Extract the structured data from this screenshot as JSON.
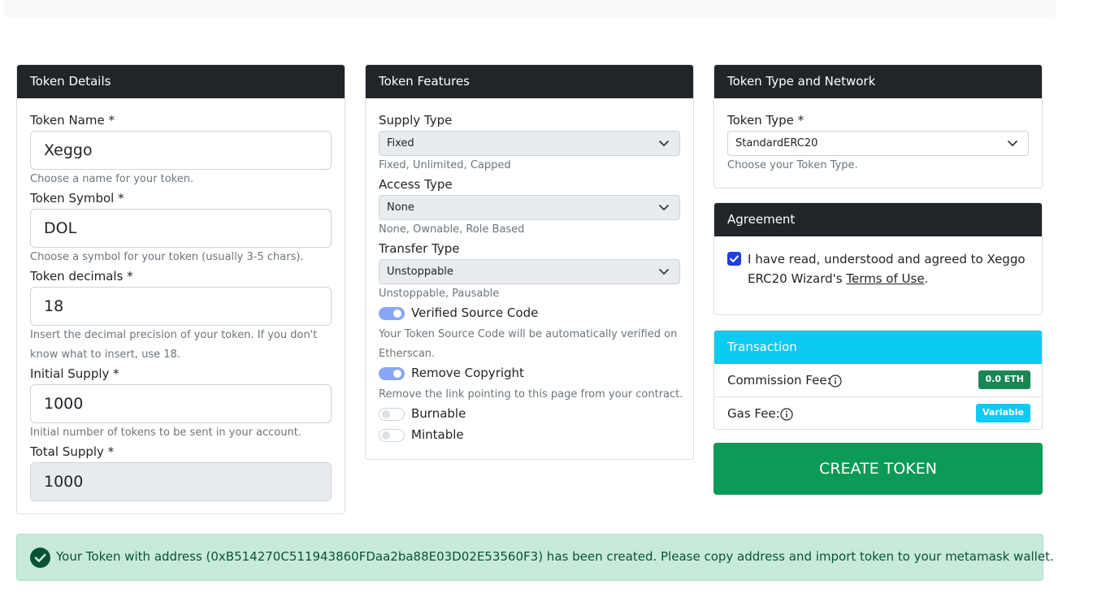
{
  "token_details": {
    "title": "Token Details",
    "name_label": "Token Name *",
    "name_value": "Xeggo",
    "name_help": "Choose a name for your token.",
    "symbol_label": "Token Symbol *",
    "symbol_value": "DOL",
    "symbol_help": "Choose a symbol for your token (usually 3-5 chars).",
    "decimals_label": "Token decimals *",
    "decimals_value": "18",
    "decimals_help_1": "Insert the decimal precision of your token. If you don't",
    "decimals_help_2": "know what to insert, use 18.",
    "initial_label": "Initial Supply *",
    "initial_value": "1000",
    "initial_help": "Initial number of tokens to be sent in your account.",
    "total_label": "Total Supply *",
    "total_value": "1000"
  },
  "token_features": {
    "title": "Token Features",
    "supply_label": "Supply Type",
    "supply_value": "Fixed",
    "supply_help": "Fixed, Unlimited, Capped",
    "access_label": "Access Type",
    "access_value": "None",
    "access_help": "None, Ownable, Role Based",
    "transfer_label": "Transfer Type",
    "transfer_value": "Unstoppable",
    "transfer_help": "Unstoppable, Pausable",
    "verified_label": "Verified Source Code",
    "verified_on": true,
    "verified_help_1": "Your Token Source Code will be automatically verified on",
    "verified_help_2": "Etherscan.",
    "copyright_label": "Remove Copyright",
    "copyright_on": true,
    "copyright_help": "Remove the link pointing to this page from your contract.",
    "burnable_label": "Burnable",
    "burnable_on": false,
    "mintable_label": "Mintable",
    "mintable_on": false
  },
  "token_type": {
    "title": "Token Type and Network",
    "type_label": "Token Type *",
    "type_value": "StandardERC20",
    "type_help": "Choose your Token Type."
  },
  "agreement": {
    "title": "Agreement",
    "checked": true,
    "text_1": "I have read, understood and agreed to Xeggo",
    "text_2": "ERC20 Wizard's ",
    "terms_link": "Terms of Use",
    "text_end": "."
  },
  "transaction": {
    "title": "Transaction",
    "commission_label": "Commission Fee:",
    "commission_value": "0.0 ETH",
    "gas_label": "Gas Fee:",
    "gas_value": "Variable"
  },
  "create_button": "CREATE TOKEN",
  "alert": {
    "message": "Your Token with address (0xB514270C511943860FDaa2ba88E03D02E53560F3) has been created. Please copy address and import token to your metamask wallet."
  },
  "colors": {
    "header_dark": "#212529",
    "info": "#0dcaf0",
    "success_button": "#0b9a58",
    "badge_green": "#198754",
    "switch_on": "#86a7f7",
    "checkbox": "#1f3ee0",
    "alert_bg": "#c7eadb",
    "alert_text": "#0a5233"
  },
  "icons": {
    "select_chevron": "chevron-down-icon",
    "info": "info-circle-icon",
    "success": "check-circle-icon",
    "checkbox": "checkbox-checked-icon"
  }
}
